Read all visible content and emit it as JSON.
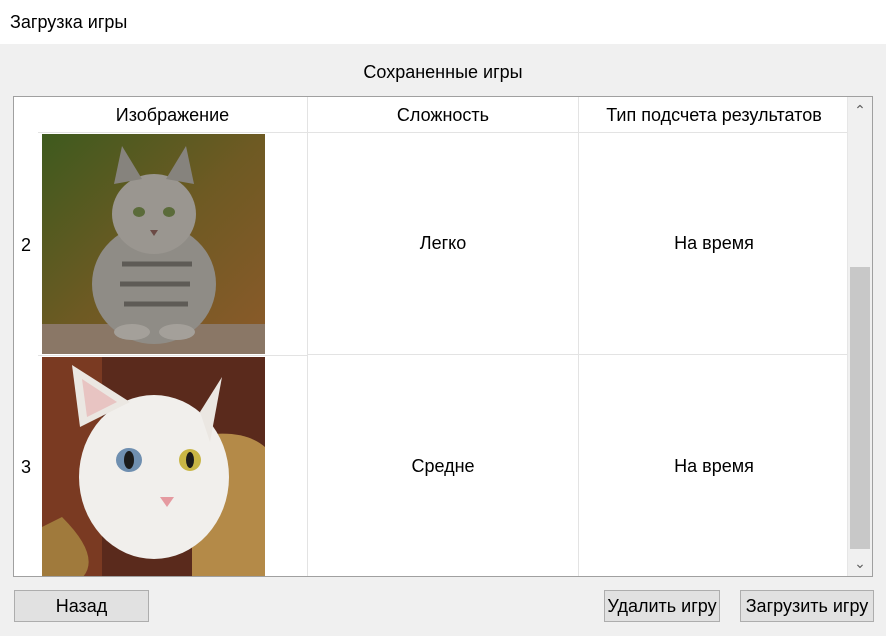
{
  "window": {
    "title": "Загрузка игры"
  },
  "section_title": "Сохраненные игры",
  "table": {
    "columns": [
      "Изображение",
      "Сложность",
      "Тип подсчета результатов"
    ],
    "rows": [
      {
        "row_header": "2",
        "image": "tabby-cat-photo",
        "difficulty": "Легко",
        "scoring": "На время"
      },
      {
        "row_header": "3",
        "image": "white-cat-photo",
        "difficulty": "Средне",
        "scoring": "На время"
      }
    ]
  },
  "buttons": {
    "back": "Назад",
    "delete": "Удалить игру",
    "load": "Загрузить игру"
  },
  "icons": {
    "scroll_up": "chevron-up-icon",
    "scroll_down": "chevron-down-icon"
  }
}
